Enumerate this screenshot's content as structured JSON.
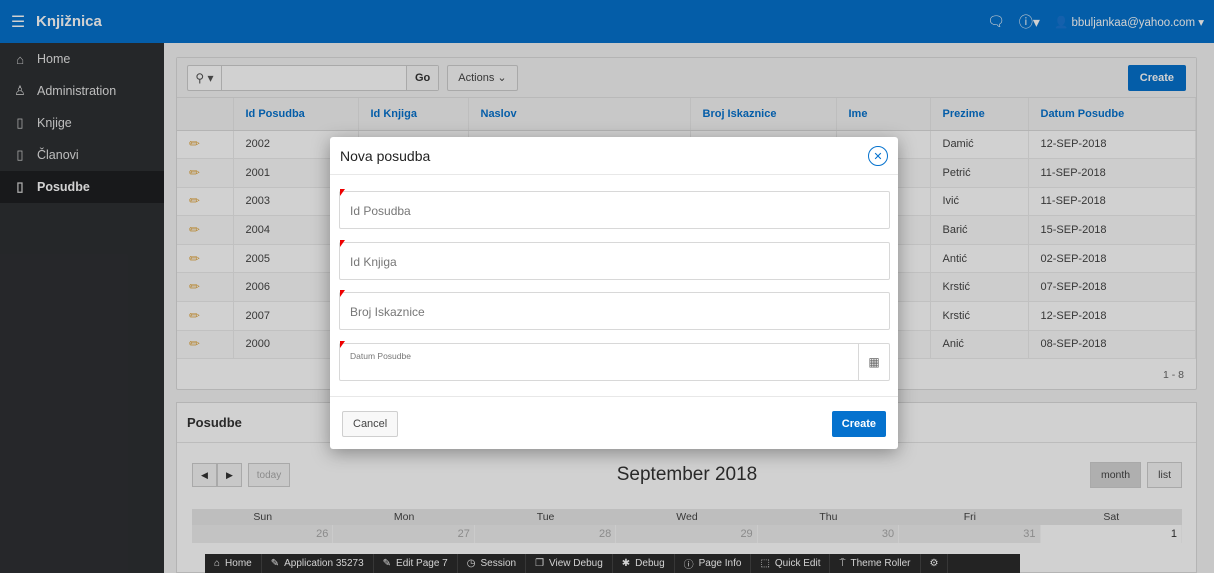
{
  "app": {
    "title": "Knjižnica"
  },
  "header": {
    "user": "bbuljankaa@yahoo.com"
  },
  "sidebar": {
    "items": [
      {
        "label": "Home",
        "icon": "home-icon"
      },
      {
        "label": "Administration",
        "icon": "user-key-icon"
      },
      {
        "label": "Knjige",
        "icon": "file-icon"
      },
      {
        "label": "Članovi",
        "icon": "file-icon"
      },
      {
        "label": "Posudbe",
        "icon": "file-icon",
        "active": true
      }
    ]
  },
  "toolbar": {
    "go_label": "Go",
    "actions_label": "Actions",
    "create_label": "Create"
  },
  "report": {
    "columns": [
      "Id Posudba",
      "Id Knjiga",
      "Naslov",
      "Broj Iskaznice",
      "Ime",
      "Prezime",
      "Datum Posudbe"
    ],
    "rows": [
      {
        "id": "2002",
        "prezime": "Damić",
        "datum": "12-SEP-2018"
      },
      {
        "id": "2001",
        "prezime": "Petrić",
        "datum": "11-SEP-2018"
      },
      {
        "id": "2003",
        "prezime": "Ivić",
        "datum": "11-SEP-2018"
      },
      {
        "id": "2004",
        "prezime": "Barić",
        "datum": "15-SEP-2018"
      },
      {
        "id": "2005",
        "prezime": "Antić",
        "datum": "02-SEP-2018"
      },
      {
        "id": "2006",
        "prezime": "Krstić",
        "datum": "07-SEP-2018"
      },
      {
        "id": "2007",
        "prezime": "Krstić",
        "datum": "12-SEP-2018"
      },
      {
        "id": "2000",
        "prezime": "Anić",
        "datum": "08-SEP-2018"
      }
    ],
    "pagination": "1 - 8"
  },
  "calendar": {
    "region_title": "Posudbe",
    "today_label": "today",
    "month_title": "September 2018",
    "view_month": "month",
    "view_list": "list",
    "day_names": [
      "Sun",
      "Mon",
      "Tue",
      "Wed",
      "Thu",
      "Fri",
      "Sat"
    ],
    "first_week": [
      "26",
      "27",
      "28",
      "29",
      "30",
      "31",
      "1"
    ]
  },
  "modal": {
    "title": "Nova posudba",
    "fields": {
      "id_posudba": "Id Posudba",
      "id_knjiga": "Id Knjiga",
      "broj_iskaznice": "Broj Iskaznice",
      "datum_posudbe": "Datum Posudbe"
    },
    "cancel_label": "Cancel",
    "create_label": "Create"
  },
  "devbar": {
    "items": [
      "Home",
      "Application 35273",
      "Edit Page 7",
      "Session",
      "View Debug",
      "Debug",
      "Page Info",
      "Quick Edit",
      "Theme Roller"
    ]
  },
  "colors": {
    "accent": "#0572ce",
    "sidebar": "#2e3033",
    "required": "#e00000"
  }
}
